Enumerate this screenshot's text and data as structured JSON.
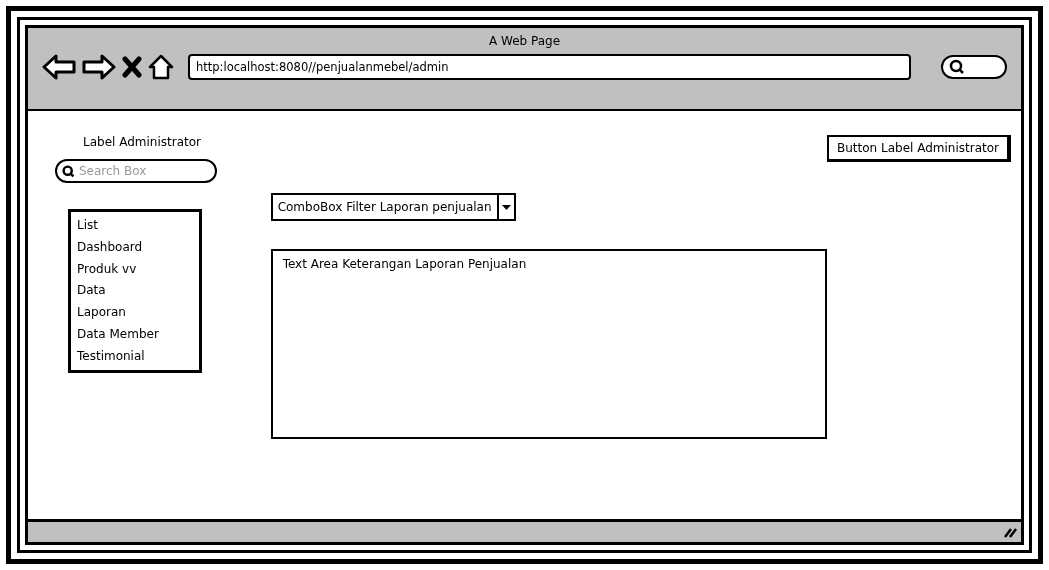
{
  "window": {
    "title": "A Web Page"
  },
  "toolbar": {
    "address": "http:localhost:8080//penjualanmebel/admin"
  },
  "page": {
    "label": "Label Administrator",
    "search": {
      "placeholder": "Search Box"
    },
    "list": {
      "items": [
        "List",
        "Dashboard",
        "Produk vv",
        "Data",
        "Laporan",
        "Data Member",
        "Testimonial"
      ]
    },
    "combobox": {
      "value": "ComboBox Filter Laporan penjualan"
    },
    "text_area": {
      "value": "Text Area Keterangan Laporan Penjualan"
    },
    "button": "Button Label Administrator"
  }
}
